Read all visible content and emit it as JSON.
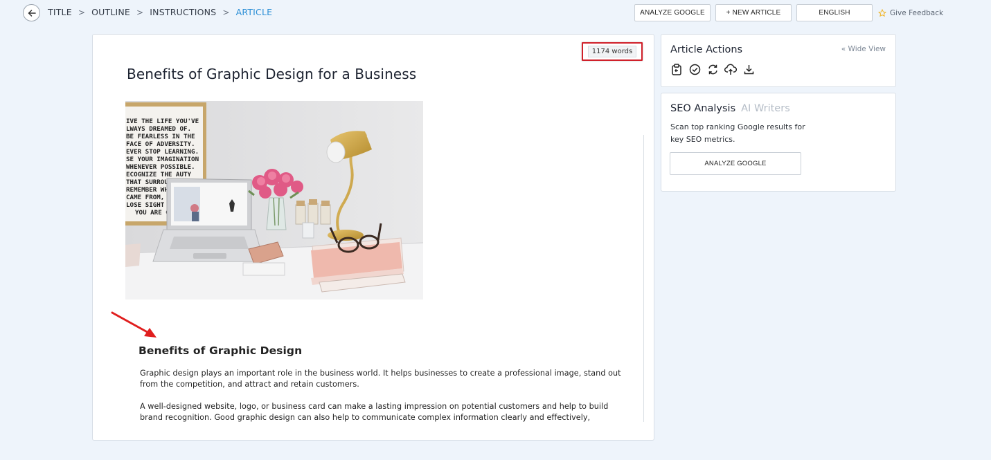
{
  "breadcrumb": {
    "items": [
      "TITLE",
      "OUTLINE",
      "INSTRUCTIONS",
      "ARTICLE"
    ],
    "separator": ">"
  },
  "toolbar": {
    "analyze_google": "ANALYZE GOOGLE",
    "new_article": "+ NEW ARTICLE",
    "language": "ENGLISH",
    "feedback": "Give Feedback"
  },
  "article": {
    "word_count": "1174 words",
    "title": "Benefits of Graphic Design for a Business",
    "image_poster_text": [
      "IVE THE LIFE YOU'VE",
      "LWAYS DREAMED OF.",
      "BE FEARLESS IN THE",
      "FACE OF ADVERSITY.",
      "EVER STOP LEARNING.",
      "SE YOUR IMAGINATION",
      "WHENEVER POSSIBLE.",
      "ECOGNIZE THE    AUTY",
      "THAT SURROUNI",
      "REMEMBER WHI",
      "CAME FROM, BU",
      "LOSE SIGHT OF",
      "YOU ARE GO"
    ],
    "section_heading": "Benefits of Graphic Design",
    "paragraphs": [
      "Graphic design plays an important role in the business world. It helps businesses to create a professional image, stand out from the competition, and attract and retain customers.",
      "A well-designed website, logo, or business card can make a lasting impression on potential customers and help to build brand recognition. Good graphic design can also help to communicate complex information clearly and effectively,"
    ]
  },
  "article_actions": {
    "title": "Article Actions",
    "wide_view": "Wide View",
    "icons": [
      "clipboard-copy-icon",
      "check-circle-icon",
      "refresh-icon",
      "upload-cloud-icon",
      "download-icon"
    ]
  },
  "seo": {
    "title": "SEO Analysis",
    "ai_writers": "AI Writers",
    "description": "Scan top ranking Google results for key SEO metrics.",
    "button": "ANALYZE GOOGLE"
  },
  "colors": {
    "accent": "#2c8fd6",
    "highlight_red": "#d0202a",
    "star": "#f0b323",
    "background": "#eef4fb"
  }
}
